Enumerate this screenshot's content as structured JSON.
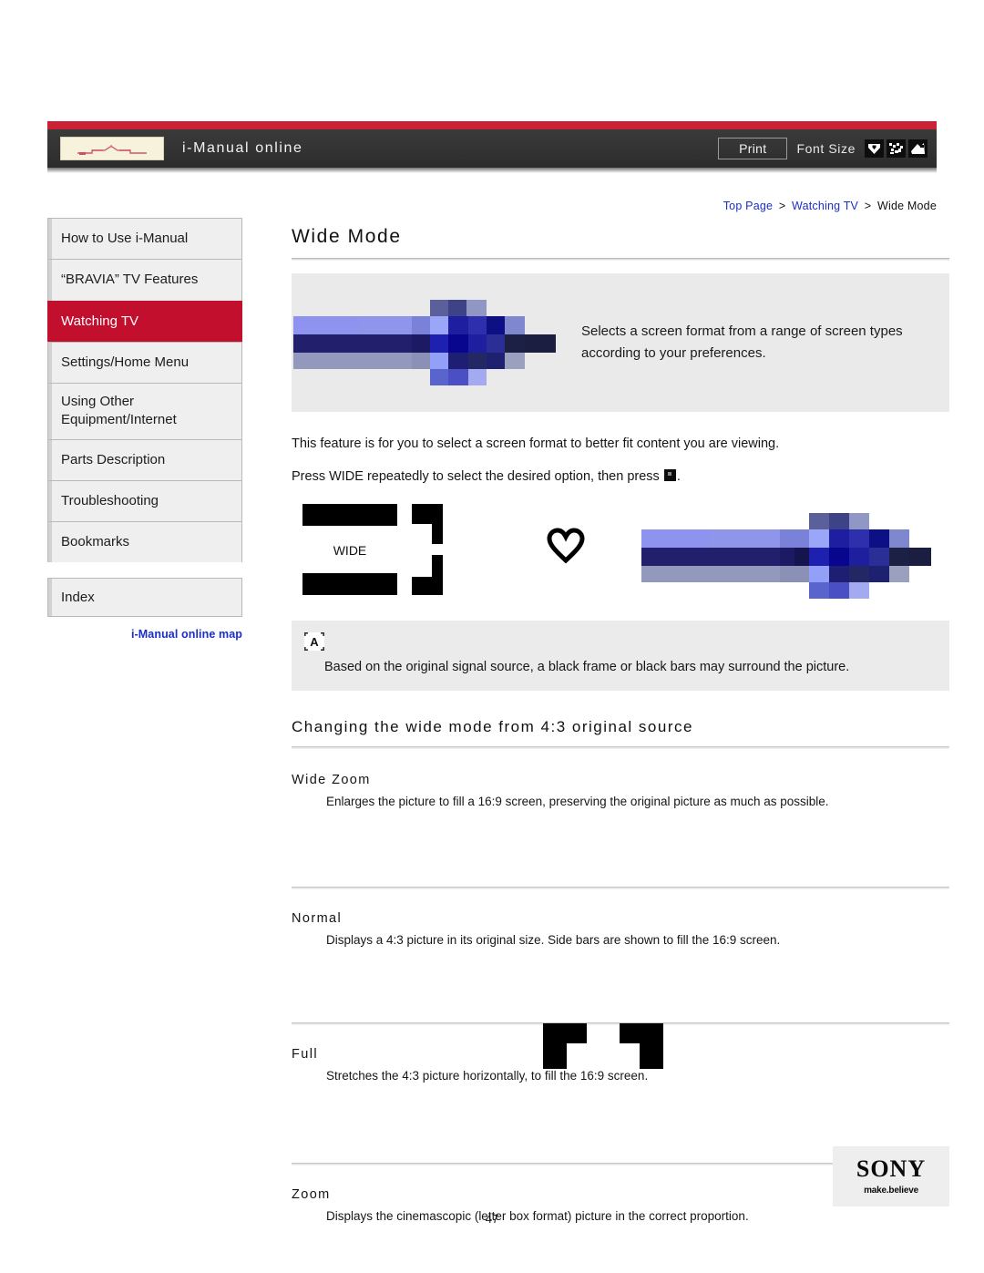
{
  "header": {
    "title": "i-Manual online",
    "logo_icon": "imanual-logo",
    "print_label": "Print",
    "font_size_label": "Font Size",
    "font_size_icons": [
      "font-size-small-icon",
      "font-size-medium-icon",
      "font-size-large-icon"
    ],
    "red_bar_color": "#cc2036",
    "bar_color": "#333333"
  },
  "breadcrumb": {
    "items": [
      {
        "label": "Top Page",
        "is_link": true
      },
      {
        "label": "Watching TV",
        "is_link": true
      },
      {
        "label": "Wide Mode",
        "is_link": false
      }
    ],
    "separator": ">",
    "link_color": "#1b2ecc"
  },
  "sidebar": {
    "items": [
      {
        "label": "How to Use i-Manual",
        "active": false
      },
      {
        "label": "“BRAVIA” TV Features",
        "active": false
      },
      {
        "label": "Watching TV",
        "active": true
      },
      {
        "label": "Settings/Home Menu",
        "active": false
      },
      {
        "label": "Using Other Equipment/Internet",
        "active": false
      },
      {
        "label": "Parts Description",
        "active": false
      },
      {
        "label": "Troubleshooting",
        "active": false
      },
      {
        "label": "Bookmarks",
        "active": false
      }
    ],
    "index_label": "Index",
    "map_link_label": "i-Manual online map",
    "active_color": "#c30f2e"
  },
  "main": {
    "page_title": "Wide Mode",
    "hero": {
      "art_icon": "wide-mode-mosaic-graphic",
      "description": "Selects a screen format from a range of screen types according to your preferences."
    },
    "paragraph_1": "This feature is for you to select a screen format to better fit content you are viewing.",
    "paragraph_2_before": "Press WIDE repeatedly to select the desired option, then press",
    "paragraph_2_after": ".",
    "enter_key_icon": "enter-key-icon",
    "wide_button_label": "WIDE",
    "wide_button_icon": "wide-remote-button",
    "heart_icon": "heart-outline-icon",
    "mosaic_icon": "wide-mode-mosaic-graphic",
    "note": {
      "badge_icon": "note-a-icon",
      "badge_label": "A",
      "text": "Based on the original signal source, a black frame or black bars may surround the picture."
    },
    "section_heading": "Changing the wide mode from 4:3 original source",
    "subsections": [
      {
        "title": "Wide Zoom",
        "description": "Enlarges the picture to fill a 16:9 screen, preserving the original picture as much as possible."
      },
      {
        "title": "Normal",
        "description": "Displays a 4:3 picture in its original size. Side bars are shown to fill the 16:9 screen."
      },
      {
        "title": "Full",
        "description": "Stretches the 4:3 picture horizontally, to fill the 16:9 screen."
      },
      {
        "title": "Zoom",
        "description": "Displays the cinemascopic (letter box format) picture in the correct proportion."
      }
    ]
  },
  "footer": {
    "page_number": "47",
    "brand_name": "SONY",
    "brand_tagline": "make.believe"
  }
}
